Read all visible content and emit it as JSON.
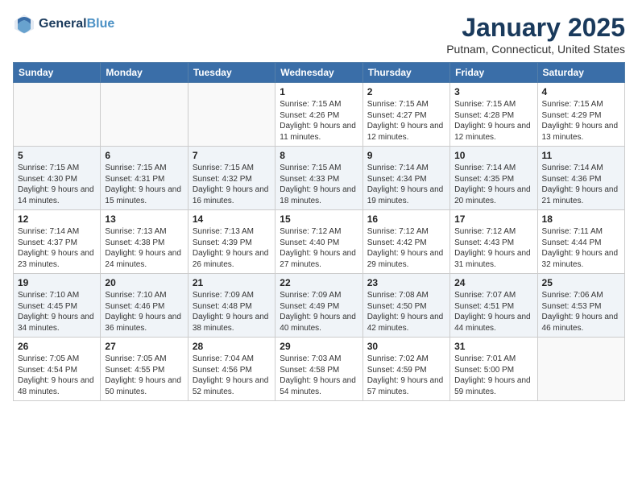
{
  "header": {
    "logo_line1": "General",
    "logo_line2": "Blue",
    "month_title": "January 2025",
    "location": "Putnam, Connecticut, United States"
  },
  "weekdays": [
    "Sunday",
    "Monday",
    "Tuesday",
    "Wednesday",
    "Thursday",
    "Friday",
    "Saturday"
  ],
  "weeks": [
    [
      {
        "day": "",
        "sunrise": "",
        "sunset": "",
        "daylight": ""
      },
      {
        "day": "",
        "sunrise": "",
        "sunset": "",
        "daylight": ""
      },
      {
        "day": "",
        "sunrise": "",
        "sunset": "",
        "daylight": ""
      },
      {
        "day": "1",
        "sunrise": "Sunrise: 7:15 AM",
        "sunset": "Sunset: 4:26 PM",
        "daylight": "Daylight: 9 hours and 11 minutes."
      },
      {
        "day": "2",
        "sunrise": "Sunrise: 7:15 AM",
        "sunset": "Sunset: 4:27 PM",
        "daylight": "Daylight: 9 hours and 12 minutes."
      },
      {
        "day": "3",
        "sunrise": "Sunrise: 7:15 AM",
        "sunset": "Sunset: 4:28 PM",
        "daylight": "Daylight: 9 hours and 12 minutes."
      },
      {
        "day": "4",
        "sunrise": "Sunrise: 7:15 AM",
        "sunset": "Sunset: 4:29 PM",
        "daylight": "Daylight: 9 hours and 13 minutes."
      }
    ],
    [
      {
        "day": "5",
        "sunrise": "Sunrise: 7:15 AM",
        "sunset": "Sunset: 4:30 PM",
        "daylight": "Daylight: 9 hours and 14 minutes."
      },
      {
        "day": "6",
        "sunrise": "Sunrise: 7:15 AM",
        "sunset": "Sunset: 4:31 PM",
        "daylight": "Daylight: 9 hours and 15 minutes."
      },
      {
        "day": "7",
        "sunrise": "Sunrise: 7:15 AM",
        "sunset": "Sunset: 4:32 PM",
        "daylight": "Daylight: 9 hours and 16 minutes."
      },
      {
        "day": "8",
        "sunrise": "Sunrise: 7:15 AM",
        "sunset": "Sunset: 4:33 PM",
        "daylight": "Daylight: 9 hours and 18 minutes."
      },
      {
        "day": "9",
        "sunrise": "Sunrise: 7:14 AM",
        "sunset": "Sunset: 4:34 PM",
        "daylight": "Daylight: 9 hours and 19 minutes."
      },
      {
        "day": "10",
        "sunrise": "Sunrise: 7:14 AM",
        "sunset": "Sunset: 4:35 PM",
        "daylight": "Daylight: 9 hours and 20 minutes."
      },
      {
        "day": "11",
        "sunrise": "Sunrise: 7:14 AM",
        "sunset": "Sunset: 4:36 PM",
        "daylight": "Daylight: 9 hours and 21 minutes."
      }
    ],
    [
      {
        "day": "12",
        "sunrise": "Sunrise: 7:14 AM",
        "sunset": "Sunset: 4:37 PM",
        "daylight": "Daylight: 9 hours and 23 minutes."
      },
      {
        "day": "13",
        "sunrise": "Sunrise: 7:13 AM",
        "sunset": "Sunset: 4:38 PM",
        "daylight": "Daylight: 9 hours and 24 minutes."
      },
      {
        "day": "14",
        "sunrise": "Sunrise: 7:13 AM",
        "sunset": "Sunset: 4:39 PM",
        "daylight": "Daylight: 9 hours and 26 minutes."
      },
      {
        "day": "15",
        "sunrise": "Sunrise: 7:12 AM",
        "sunset": "Sunset: 4:40 PM",
        "daylight": "Daylight: 9 hours and 27 minutes."
      },
      {
        "day": "16",
        "sunrise": "Sunrise: 7:12 AM",
        "sunset": "Sunset: 4:42 PM",
        "daylight": "Daylight: 9 hours and 29 minutes."
      },
      {
        "day": "17",
        "sunrise": "Sunrise: 7:12 AM",
        "sunset": "Sunset: 4:43 PM",
        "daylight": "Daylight: 9 hours and 31 minutes."
      },
      {
        "day": "18",
        "sunrise": "Sunrise: 7:11 AM",
        "sunset": "Sunset: 4:44 PM",
        "daylight": "Daylight: 9 hours and 32 minutes."
      }
    ],
    [
      {
        "day": "19",
        "sunrise": "Sunrise: 7:10 AM",
        "sunset": "Sunset: 4:45 PM",
        "daylight": "Daylight: 9 hours and 34 minutes."
      },
      {
        "day": "20",
        "sunrise": "Sunrise: 7:10 AM",
        "sunset": "Sunset: 4:46 PM",
        "daylight": "Daylight: 9 hours and 36 minutes."
      },
      {
        "day": "21",
        "sunrise": "Sunrise: 7:09 AM",
        "sunset": "Sunset: 4:48 PM",
        "daylight": "Daylight: 9 hours and 38 minutes."
      },
      {
        "day": "22",
        "sunrise": "Sunrise: 7:09 AM",
        "sunset": "Sunset: 4:49 PM",
        "daylight": "Daylight: 9 hours and 40 minutes."
      },
      {
        "day": "23",
        "sunrise": "Sunrise: 7:08 AM",
        "sunset": "Sunset: 4:50 PM",
        "daylight": "Daylight: 9 hours and 42 minutes."
      },
      {
        "day": "24",
        "sunrise": "Sunrise: 7:07 AM",
        "sunset": "Sunset: 4:51 PM",
        "daylight": "Daylight: 9 hours and 44 minutes."
      },
      {
        "day": "25",
        "sunrise": "Sunrise: 7:06 AM",
        "sunset": "Sunset: 4:53 PM",
        "daylight": "Daylight: 9 hours and 46 minutes."
      }
    ],
    [
      {
        "day": "26",
        "sunrise": "Sunrise: 7:05 AM",
        "sunset": "Sunset: 4:54 PM",
        "daylight": "Daylight: 9 hours and 48 minutes."
      },
      {
        "day": "27",
        "sunrise": "Sunrise: 7:05 AM",
        "sunset": "Sunset: 4:55 PM",
        "daylight": "Daylight: 9 hours and 50 minutes."
      },
      {
        "day": "28",
        "sunrise": "Sunrise: 7:04 AM",
        "sunset": "Sunset: 4:56 PM",
        "daylight": "Daylight: 9 hours and 52 minutes."
      },
      {
        "day": "29",
        "sunrise": "Sunrise: 7:03 AM",
        "sunset": "Sunset: 4:58 PM",
        "daylight": "Daylight: 9 hours and 54 minutes."
      },
      {
        "day": "30",
        "sunrise": "Sunrise: 7:02 AM",
        "sunset": "Sunset: 4:59 PM",
        "daylight": "Daylight: 9 hours and 57 minutes."
      },
      {
        "day": "31",
        "sunrise": "Sunrise: 7:01 AM",
        "sunset": "Sunset: 5:00 PM",
        "daylight": "Daylight: 9 hours and 59 minutes."
      },
      {
        "day": "",
        "sunrise": "",
        "sunset": "",
        "daylight": ""
      }
    ]
  ]
}
